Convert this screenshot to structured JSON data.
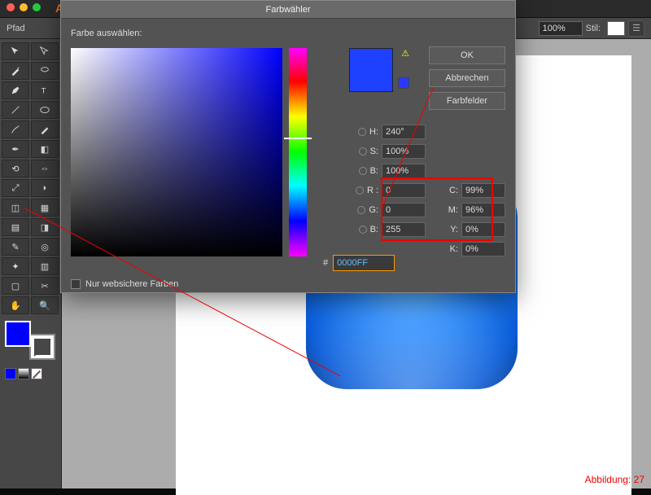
{
  "traffic": {
    "red": "#ff5f57",
    "yellow": "#febc2e",
    "green": "#28c840"
  },
  "app": {
    "logo": "Ai"
  },
  "ctrl": {
    "path": "Pfad",
    "zoom": "100%",
    "stil": "Stil:"
  },
  "dialog": {
    "title": "Farbwähler",
    "prompt": "Farbe auswählen:",
    "ok": "OK",
    "cancel": "Abbrechen",
    "swatches": "Farbfelder",
    "websafe": "Nur websichere Farben",
    "hex_label": "#",
    "hex": "0000FF",
    "hsb": {
      "H": "240°",
      "S": "100%",
      "B": "100%"
    },
    "rgb": {
      "R": "0",
      "G": "0",
      "B": "255"
    },
    "cmyk": {
      "C": "99%",
      "M": "96%",
      "Y": "0%",
      "K": "0%"
    }
  },
  "caption": "Abbildung: 27"
}
